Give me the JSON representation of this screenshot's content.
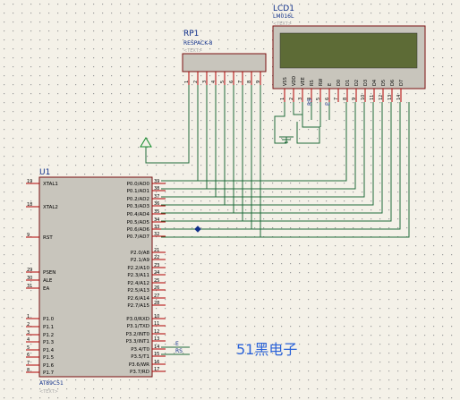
{
  "colors": {
    "background": "#f4f1e8",
    "grid_dot": "#9c9c9c",
    "wire": "#1f6b3a",
    "pin": "#b00000",
    "chip_fill": "#c8c5bc",
    "chip_border": "#7a1010",
    "lcd_bezel": "#c8c5bc",
    "lcd_screen": "#5d6b36",
    "label_blue": "#0f2f8a",
    "watermark": "#2a62d8",
    "text_gray": "#a7a7a7",
    "power_green": "#118a2a"
  },
  "rp1": {
    "ref": "RP1",
    "part": "RESPACK-8",
    "text_placeholder": "<TEXT>",
    "pin_numbers": [
      "1",
      "2",
      "3",
      "4",
      "5",
      "6",
      "7",
      "8",
      "9"
    ]
  },
  "lcd1": {
    "ref": "LCD1",
    "part": "LM016L",
    "text_placeholder": "<TEXT>",
    "pin_labels": [
      "VSS",
      "VDD",
      "VEE",
      "RS",
      "RW",
      "E",
      "D0",
      "D1",
      "D2",
      "D3",
      "D4",
      "D5",
      "D6",
      "D7"
    ],
    "pin_numbers": [
      "1",
      "2",
      "3",
      "4",
      "5",
      "6",
      "7",
      "8",
      "9",
      "10",
      "11",
      "12",
      "13",
      "14"
    ]
  },
  "u1": {
    "ref": "U1",
    "part": "AT89C51",
    "text_placeholder": "<TEXT>",
    "left_pins": [
      {
        "num": "19",
        "label": "XTAL1"
      },
      {
        "num": "18",
        "label": "XTAL2"
      },
      {
        "num": "9",
        "label": "RST"
      },
      {
        "num": "29",
        "label": "PSEN"
      },
      {
        "num": "30",
        "label": "ALE"
      },
      {
        "num": "31",
        "label": "EA"
      },
      {
        "num": "1",
        "label": "P1.0"
      },
      {
        "num": "2",
        "label": "P1.1"
      },
      {
        "num": "3",
        "label": "P1.2"
      },
      {
        "num": "4",
        "label": "P1.3"
      },
      {
        "num": "5",
        "label": "P1.4"
      },
      {
        "num": "6",
        "label": "P1.5"
      },
      {
        "num": "7",
        "label": "P1.6"
      },
      {
        "num": "8",
        "label": "P1.7"
      }
    ],
    "right_pins": [
      {
        "num": "39",
        "label": "P0.0/AD0"
      },
      {
        "num": "38",
        "label": "P0.1/AD1"
      },
      {
        "num": "37",
        "label": "P0.2/AD2"
      },
      {
        "num": "36",
        "label": "P0.3/AD3"
      },
      {
        "num": "35",
        "label": "P0.4/AD4"
      },
      {
        "num": "34",
        "label": "P0.5/AD5"
      },
      {
        "num": "33",
        "label": "P0.6/AD6"
      },
      {
        "num": "32",
        "label": "P0.7/AD7"
      },
      {
        "num": "21",
        "label": "P2.0/A8"
      },
      {
        "num": "22",
        "label": "P2.1/A9"
      },
      {
        "num": "23",
        "label": "P2.2/A10"
      },
      {
        "num": "24",
        "label": "P2.3/A11"
      },
      {
        "num": "25",
        "label": "P2.4/A12"
      },
      {
        "num": "26",
        "label": "P2.5/A13"
      },
      {
        "num": "27",
        "label": "P2.6/A14"
      },
      {
        "num": "28",
        "label": "P2.7/A15"
      },
      {
        "num": "10",
        "label": "P3.0/RXD"
      },
      {
        "num": "11",
        "label": "P3.1/TXD"
      },
      {
        "num": "12",
        "label": "P3.2/INT0"
      },
      {
        "num": "13",
        "label": "P3.3/INT1"
      },
      {
        "num": "14",
        "label": "P3.4/T0"
      },
      {
        "num": "15",
        "label": "P3.5/T1"
      },
      {
        "num": "16",
        "label": "P3.6/WR"
      },
      {
        "num": "17",
        "label": "P3.7/RD"
      }
    ]
  },
  "net_labels": {
    "rs_lcd": "RS",
    "e_lcd": "E",
    "e_mcu": "E",
    "rs_mcu": "RS"
  },
  "watermark": "51黑电子"
}
